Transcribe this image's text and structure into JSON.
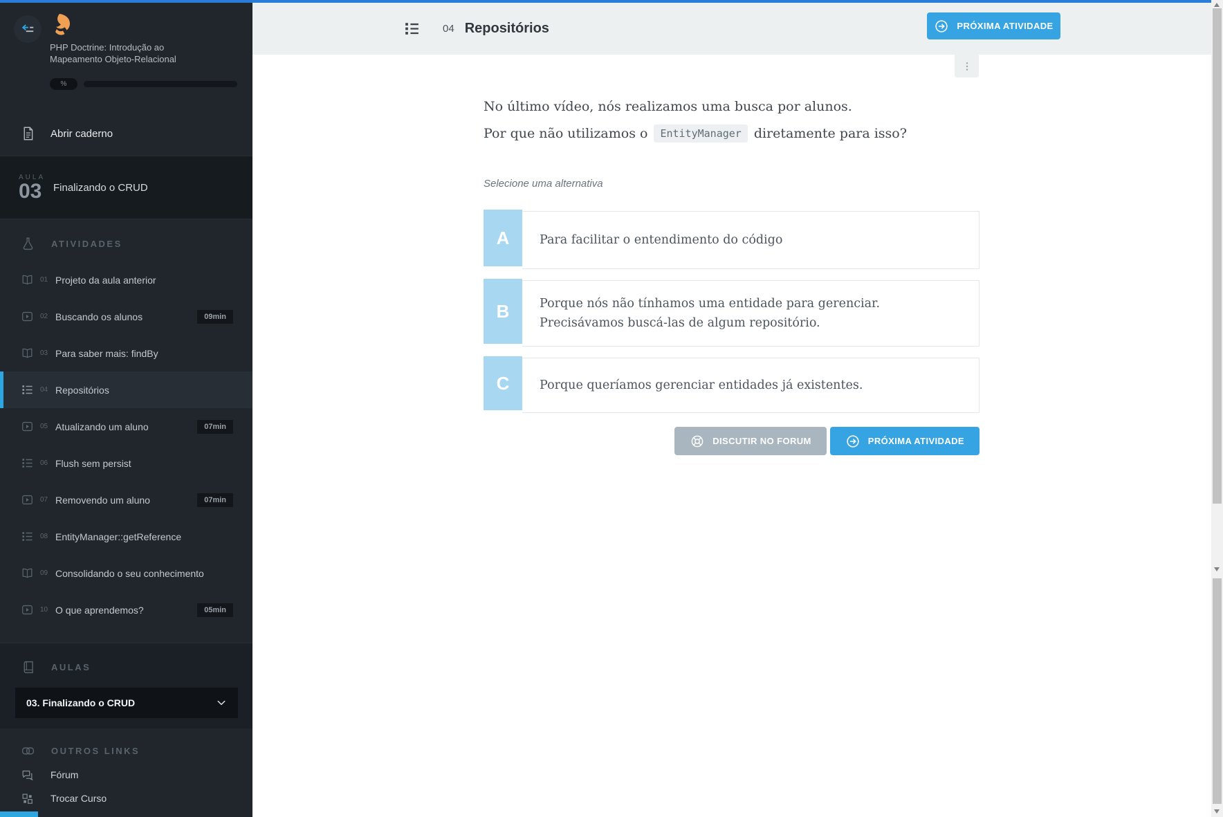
{
  "colors": {
    "top_line_blue": "#2b7cd9",
    "accent_blue": "#2da7e2",
    "button_blue": "#36a3e2",
    "button_gray": "#a9b6bf",
    "letter_box_blue": "#a8d7f2",
    "sidebar_bg": "#20262c",
    "brand_orange": "#f0a055"
  },
  "sidebar": {
    "course_title_line1": "PHP Doctrine: Introdução ao",
    "course_title_line2": "Mapeamento Objeto-Relacional",
    "progress_label": "%",
    "open_notebook_label": "Abrir caderno",
    "lesson_word": "AULA",
    "lesson_number": "03",
    "lesson_title": "Finalizando o CRUD",
    "activities_header": "ATIVIDADES",
    "activities": [
      {
        "num": "01",
        "label": "Projeto da aula anterior",
        "icon": "book-open",
        "duration": ""
      },
      {
        "num": "02",
        "label": "Buscando os alunos",
        "icon": "video",
        "duration": "09min"
      },
      {
        "num": "03",
        "label": "Para saber mais: findBy",
        "icon": "book-open",
        "duration": ""
      },
      {
        "num": "04",
        "label": "Repositórios",
        "icon": "list",
        "duration": "",
        "selected": true
      },
      {
        "num": "05",
        "label": "Atualizando um aluno",
        "icon": "video",
        "duration": "07min"
      },
      {
        "num": "06",
        "label": "Flush sem persist",
        "icon": "list",
        "duration": ""
      },
      {
        "num": "07",
        "label": "Removendo um aluno",
        "icon": "video",
        "duration": "07min"
      },
      {
        "num": "08",
        "label": "EntityManager::getReference",
        "icon": "list",
        "duration": ""
      },
      {
        "num": "09",
        "label": "Consolidando o seu conhecimento",
        "icon": "book-open",
        "duration": ""
      },
      {
        "num": "10",
        "label": "O que aprendemos?",
        "icon": "video",
        "duration": "05min"
      }
    ],
    "aulas_header": "AULAS",
    "aulas_dropdown_value": "03. Finalizando o CRUD",
    "other_links_header": "OUTROS LINKS",
    "links": [
      {
        "label": "Fórum",
        "icon": "forum"
      },
      {
        "label": "Trocar Curso",
        "icon": "grid"
      }
    ]
  },
  "header": {
    "activity_number": "04",
    "activity_title": "Repositórios",
    "next_button_label": "PRÓXIMA ATIVIDADE"
  },
  "content": {
    "question_line1": "No último vídeo, nós realizamos uma busca por alunos.",
    "question_line2_prefix": "Por que não utilizamos o",
    "question_code": "EntityManager",
    "question_line2_suffix": "diretamente para isso?",
    "select_prompt": "Selecione uma alternativa",
    "alternatives": [
      {
        "letter": "A",
        "text": "Para facilitar o entendimento do código"
      },
      {
        "letter": "B",
        "text": "Porque nós não tínhamos uma entidade para gerenciar. Precisávamos buscá-las de algum repositório."
      },
      {
        "letter": "C",
        "text": "Porque queríamos gerenciar entidades já existentes."
      }
    ],
    "forum_button_label": "DISCUTIR NO FORUM",
    "next_button_label": "PRÓXIMA ATIVIDADE"
  }
}
